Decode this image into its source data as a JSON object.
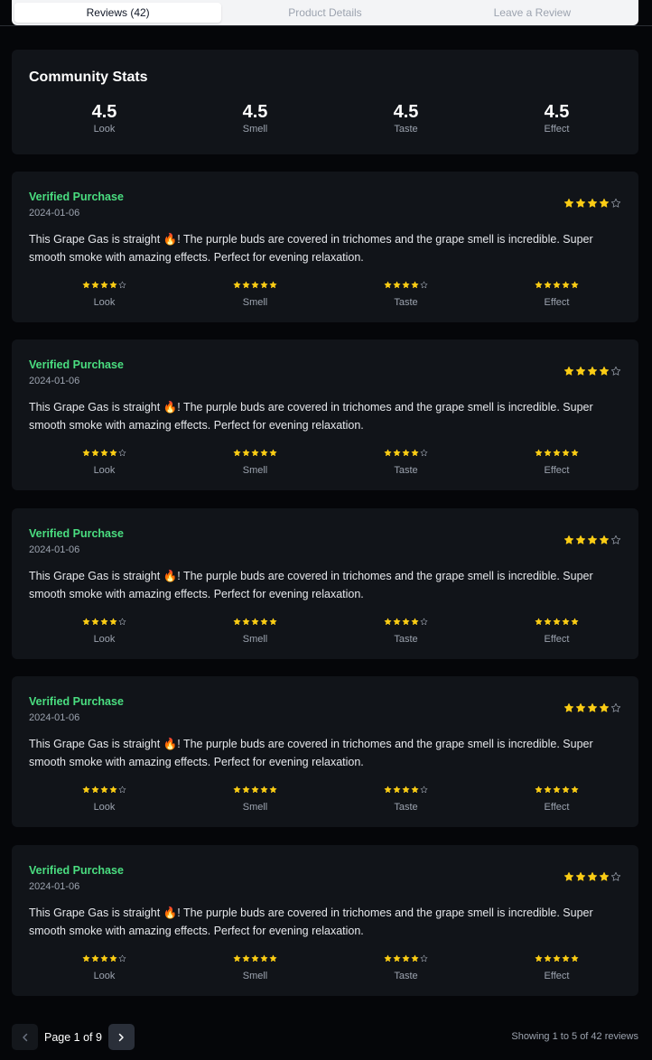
{
  "tabs": [
    {
      "label": "Reviews (42)",
      "active": true
    },
    {
      "label": "Product Details",
      "active": false
    },
    {
      "label": "Leave a Review",
      "active": false
    }
  ],
  "stats": {
    "title": "Community Stats",
    "items": [
      {
        "value": "4.5",
        "label": "Look"
      },
      {
        "value": "4.5",
        "label": "Smell"
      },
      {
        "value": "4.5",
        "label": "Taste"
      },
      {
        "value": "4.5",
        "label": "Effect"
      }
    ]
  },
  "reviews": [
    {
      "verified": "Verified Purchase",
      "date": "2024-01-06",
      "overall_rating": 4,
      "text": "This Grape Gas is straight 🔥! The purple buds are covered in trichomes and the grape smell is incredible. Super smooth smoke with amazing effects. Perfect for evening relaxation.",
      "sub": [
        {
          "label": "Look",
          "rating": 4
        },
        {
          "label": "Smell",
          "rating": 5
        },
        {
          "label": "Taste",
          "rating": 4
        },
        {
          "label": "Effect",
          "rating": 5
        }
      ]
    },
    {
      "verified": "Verified Purchase",
      "date": "2024-01-06",
      "overall_rating": 4,
      "text": "This Grape Gas is straight 🔥! The purple buds are covered in trichomes and the grape smell is incredible. Super smooth smoke with amazing effects. Perfect for evening relaxation.",
      "sub": [
        {
          "label": "Look",
          "rating": 4
        },
        {
          "label": "Smell",
          "rating": 5
        },
        {
          "label": "Taste",
          "rating": 4
        },
        {
          "label": "Effect",
          "rating": 5
        }
      ]
    },
    {
      "verified": "Verified Purchase",
      "date": "2024-01-06",
      "overall_rating": 4,
      "text": "This Grape Gas is straight 🔥! The purple buds are covered in trichomes and the grape smell is incredible. Super smooth smoke with amazing effects. Perfect for evening relaxation.",
      "sub": [
        {
          "label": "Look",
          "rating": 4
        },
        {
          "label": "Smell",
          "rating": 5
        },
        {
          "label": "Taste",
          "rating": 4
        },
        {
          "label": "Effect",
          "rating": 5
        }
      ]
    },
    {
      "verified": "Verified Purchase",
      "date": "2024-01-06",
      "overall_rating": 4,
      "text": "This Grape Gas is straight 🔥! The purple buds are covered in trichomes and the grape smell is incredible. Super smooth smoke with amazing effects. Perfect for evening relaxation.",
      "sub": [
        {
          "label": "Look",
          "rating": 4
        },
        {
          "label": "Smell",
          "rating": 5
        },
        {
          "label": "Taste",
          "rating": 4
        },
        {
          "label": "Effect",
          "rating": 5
        }
      ]
    },
    {
      "verified": "Verified Purchase",
      "date": "2024-01-06",
      "overall_rating": 4,
      "text": "This Grape Gas is straight 🔥! The purple buds are covered in trichomes and the grape smell is incredible. Super smooth smoke with amazing effects. Perfect for evening relaxation.",
      "sub": [
        {
          "label": "Look",
          "rating": 4
        },
        {
          "label": "Smell",
          "rating": 5
        },
        {
          "label": "Taste",
          "rating": 4
        },
        {
          "label": "Effect",
          "rating": 5
        }
      ]
    }
  ],
  "rating_max": 5,
  "pagination": {
    "page_label": "Page 1 of 9",
    "prev_icon": "chevron-left-icon",
    "next_icon": "chevron-right-icon",
    "showing": "Showing 1 to 5 of 42 reviews"
  },
  "colors": {
    "star": "#facc15",
    "verified": "#4ade80",
    "card_bg": "#111419",
    "page_bg": "#050609"
  }
}
